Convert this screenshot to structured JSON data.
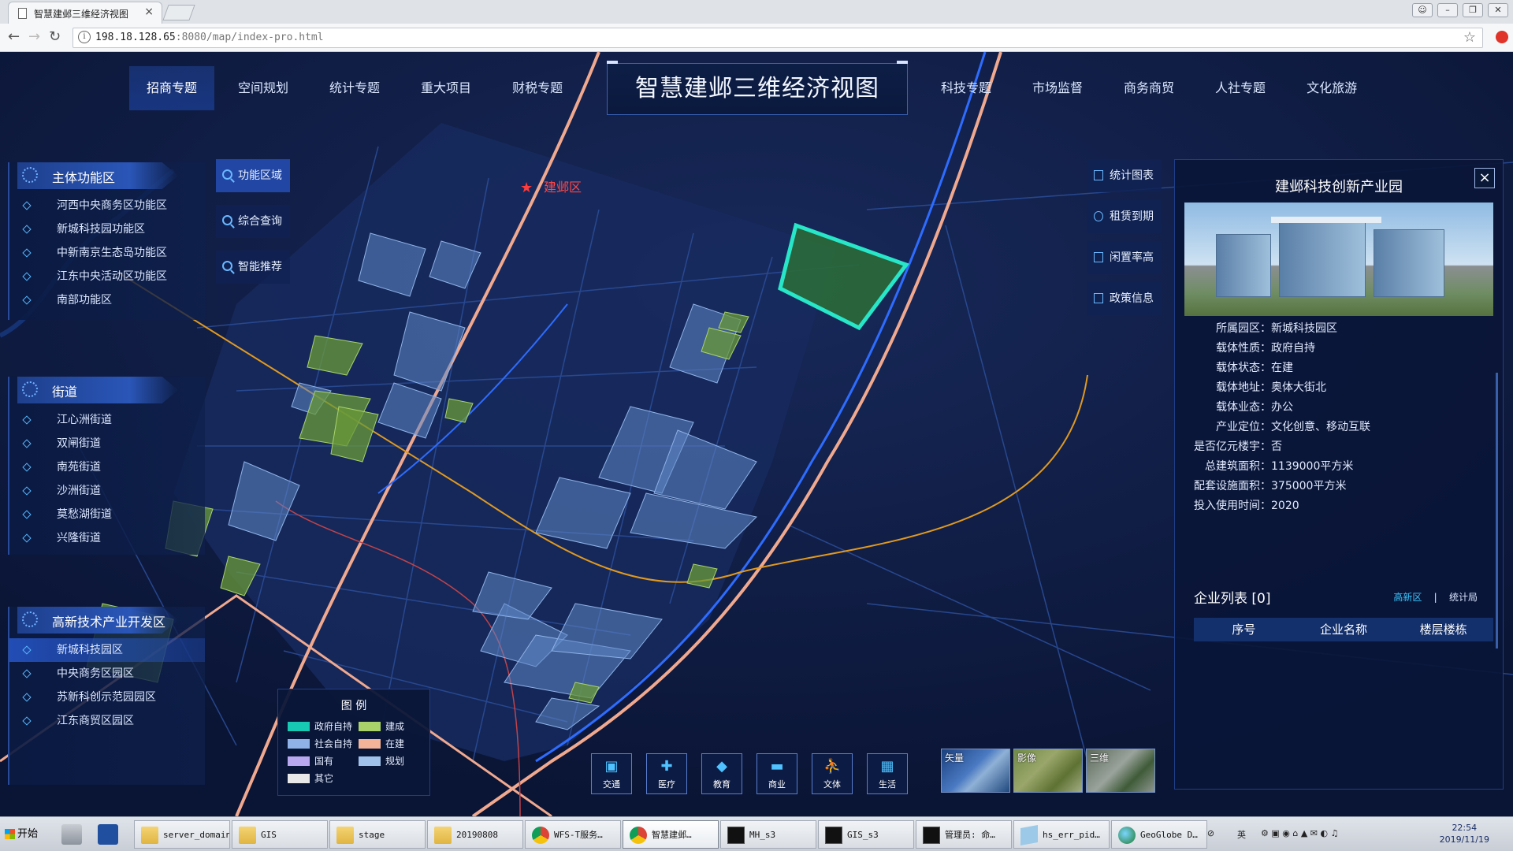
{
  "browser": {
    "tab_title": "智慧建邺三维经济视图",
    "tab_close": "×",
    "url_host": "198.18.128.65",
    "url_rest": ":8080/map/index-pro.html"
  },
  "app": {
    "title": "智慧建邺三维经济视图",
    "nav_left": [
      "招商专题",
      "空间规划",
      "统计专题",
      "重大项目",
      "财税专题"
    ],
    "nav_right": [
      "科技专题",
      "市场监督",
      "商务商贸",
      "人社专题",
      "文化旅游"
    ],
    "map_label": "建邺区",
    "panels": {
      "main_zone": {
        "title": "主体功能区",
        "items": [
          "河西中央商务区功能区",
          "新城科技园功能区",
          "中新南京生态岛功能区",
          "江东中央活动区功能区",
          "南部功能区"
        ]
      },
      "streets": {
        "title": "街道",
        "items": [
          "江心洲街道",
          "双闸街道",
          "南苑街道",
          "沙洲街道",
          "莫愁湖街道",
          "兴隆街道"
        ]
      },
      "hitech": {
        "title": "高新技术产业开发区",
        "items": [
          "新城科技园区",
          "中央商务区园区",
          "苏新科创示范园园区",
          "江东商贸区园区"
        ]
      }
    },
    "func_buttons": [
      "功能区域",
      "综合查询",
      "智能推荐"
    ],
    "right_buttons": [
      "统计图表",
      "租赁到期",
      "闲置率高",
      "政策信息"
    ],
    "info": {
      "close": "×",
      "title": "建邺科技创新产业园",
      "rows": [
        {
          "k": "所属园区：",
          "v": "新城科技园区"
        },
        {
          "k": "载体性质：",
          "v": "政府自持"
        },
        {
          "k": "载体状态：",
          "v": "在建"
        },
        {
          "k": "载体地址：",
          "v": "奥体大街北"
        },
        {
          "k": "载体业态：",
          "v": "办公"
        },
        {
          "k": "产业定位：",
          "v": "文化创意、移动互联"
        },
        {
          "k": "是否亿元楼宇：",
          "v": "否"
        },
        {
          "k": "总建筑面积：",
          "v": "1139000平方米"
        },
        {
          "k": "配套设施面积：",
          "v": "375000平方米"
        },
        {
          "k": "投入使用时间：",
          "v": "2020"
        }
      ],
      "enterprise_list_title": "企业列表 [0]",
      "tab_a": "高新区",
      "tab_sep": "|",
      "tab_b": "统计局",
      "columns": [
        "序号",
        "企业名称",
        "楼层楼栋"
      ]
    },
    "legend": {
      "title": "图 例",
      "items": [
        {
          "label": "政府自持",
          "color": "#17c9b2"
        },
        {
          "label": "建成",
          "color": "#a9d36a"
        },
        {
          "label": "社会自持",
          "color": "#8fb3e8"
        },
        {
          "label": "在建",
          "color": "#f4b49a"
        },
        {
          "label": "国有",
          "color": "#b9a8f0"
        },
        {
          "label": "规划",
          "color": "#9fc1ea"
        },
        {
          "label": "其它",
          "color": "#e8e8e8"
        }
      ]
    },
    "categories": [
      {
        "label": "交通",
        "icon": "bus-icon"
      },
      {
        "label": "医疗",
        "icon": "medical-icon"
      },
      {
        "label": "教育",
        "icon": "graduation-cap-icon"
      },
      {
        "label": "商业",
        "icon": "bed-icon"
      },
      {
        "label": "文体",
        "icon": "sports-icon"
      },
      {
        "label": "生活",
        "icon": "building-icon"
      }
    ],
    "basemaps": [
      "矢量",
      "影像",
      "三维"
    ]
  },
  "taskbar": {
    "start": "开始",
    "tasks": [
      {
        "label": "server_domain",
        "icon": "folder"
      },
      {
        "label": "GIS",
        "icon": "folder"
      },
      {
        "label": "stage",
        "icon": "folder"
      },
      {
        "label": "20190808",
        "icon": "folder"
      },
      {
        "label": "WFS-T服务…",
        "icon": "chrome"
      },
      {
        "label": "智慧建邺…",
        "icon": "chrome",
        "active": true
      },
      {
        "label": "MH_s3",
        "icon": "cmd"
      },
      {
        "label": "GIS_s3",
        "icon": "cmd"
      },
      {
        "label": "管理员: 命…",
        "icon": "cmd"
      },
      {
        "label": "hs_err_pid…",
        "icon": "doc"
      },
      {
        "label": "GeoGlobe D…",
        "icon": "globe"
      }
    ],
    "ime": "英",
    "time": "22:54",
    "date": "2019/11/19"
  }
}
